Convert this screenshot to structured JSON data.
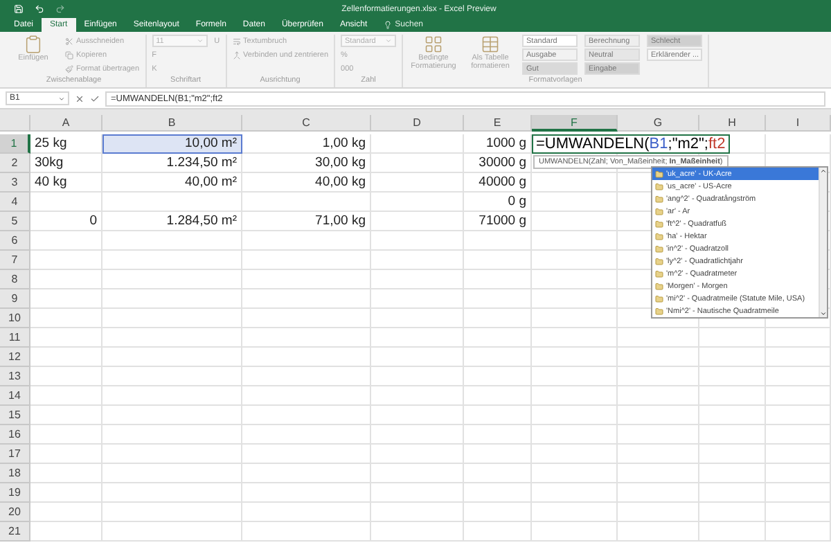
{
  "window": {
    "title": "Zellenformatierungen.xlsx  -  Excel Preview"
  },
  "tabs": [
    {
      "label": "Datei",
      "selected": false
    },
    {
      "label": "Start",
      "selected": true
    },
    {
      "label": "Einfügen",
      "selected": false
    },
    {
      "label": "Seitenlayout",
      "selected": false
    },
    {
      "label": "Formeln",
      "selected": false
    },
    {
      "label": "Daten",
      "selected": false
    },
    {
      "label": "Überprüfen",
      "selected": false
    },
    {
      "label": "Ansicht",
      "selected": false
    }
  ],
  "search": {
    "placeholder": "Suchen"
  },
  "ribbon": {
    "groups": [
      {
        "label": "Zwischenablage",
        "items": [
          {
            "kind": "paste",
            "label": "Einfügen"
          },
          {
            "kind": "cut",
            "label": "Ausschneiden"
          },
          {
            "kind": "copy",
            "label": "Kopieren"
          },
          {
            "kind": "brush",
            "label": "Format übertragen"
          }
        ]
      },
      {
        "label": "Schriftart",
        "items": [
          {
            "kind": "field",
            "value": "11"
          },
          {
            "kind": "glyph",
            "label": "F"
          },
          {
            "kind": "glyph",
            "label": "K"
          },
          {
            "kind": "glyph",
            "label": "U"
          }
        ]
      },
      {
        "label": "Ausrichtung",
        "items": [
          {
            "kind": "wrap",
            "label": "Textumbruch"
          },
          {
            "kind": "merge",
            "label": "Verbinden und zentrieren"
          }
        ]
      },
      {
        "label": "Zahl",
        "items": [
          {
            "kind": "field",
            "value": "Standard"
          },
          {
            "kind": "glyph",
            "label": "%"
          },
          {
            "kind": "glyph",
            "label": "000"
          }
        ]
      },
      {
        "label": "Formatvorlagen",
        "items": [
          {
            "kind": "conditional",
            "label": "Bedingte Formatierung"
          },
          {
            "kind": "table",
            "label": "Als Tabelle formatieren"
          },
          {
            "kind": "style",
            "label": "Standard",
            "color": "#ffffff"
          },
          {
            "kind": "style",
            "label": "Ausgabe",
            "color": "#f2f2f2"
          },
          {
            "kind": "style",
            "label": "Gut",
            "color": "#d9d9d9"
          },
          {
            "kind": "style",
            "label": "Berechnung",
            "color": "#eeeeee"
          },
          {
            "kind": "style",
            "label": "Neutral",
            "color": "#e6e6e6"
          },
          {
            "kind": "style",
            "label": "Eingabe",
            "color": "#d0d0d0"
          },
          {
            "kind": "style",
            "label": "Schlecht",
            "color": "#cfcfcf"
          },
          {
            "kind": "style",
            "label": "Erklärender ...",
            "color": "#f7f7f7"
          }
        ]
      }
    ]
  },
  "formula_bar": {
    "name_box": "B1",
    "formula": "=UMWANDELN(B1;\"m2\";ft2"
  },
  "sheet": {
    "columns": [
      {
        "label": "A",
        "selected": false
      },
      {
        "label": "B",
        "selected": false
      },
      {
        "label": "C",
        "selected": false
      },
      {
        "label": "D",
        "selected": false
      },
      {
        "label": "E",
        "selected": false
      },
      {
        "label": "F",
        "selected": true
      },
      {
        "label": "G",
        "selected": false
      },
      {
        "label": "H",
        "selected": false
      },
      {
        "label": "I",
        "selected": false
      }
    ],
    "rows": [
      {
        "number": "1",
        "selected": true,
        "a": {
          "text": "25 kg",
          "kind": "text"
        },
        "b": {
          "text": "10,00 m²",
          "kind": "number",
          "referenced": true
        },
        "c": {
          "text": "1,00 kg",
          "kind": "number"
        },
        "e": {
          "text": "1000  g",
          "kind": "number"
        },
        "f": {
          "kind": "formula",
          "parts": [
            {
              "text": "=UMWANDELN(",
              "color": "#000000"
            },
            {
              "text": "B1",
              "color": "#3c5fc8"
            },
            {
              "text": ";\"m2\";",
              "color": "#000000"
            },
            {
              "text": "ft2",
              "color": "#c0392b"
            }
          ]
        }
      },
      {
        "number": "2",
        "selected": false,
        "a": {
          "text": "30kg",
          "kind": "text"
        },
        "b": {
          "text": "1.234,50 m²",
          "kind": "number"
        },
        "c": {
          "text": "30,00 kg",
          "kind": "number"
        },
        "e": {
          "text": "30000  g",
          "kind": "number"
        }
      },
      {
        "number": "3",
        "selected": false,
        "a": {
          "text": "40 kg",
          "kind": "text"
        },
        "b": {
          "text": "40,00 m²",
          "kind": "number"
        },
        "c": {
          "text": "40,00 kg",
          "kind": "number"
        },
        "e": {
          "text": "40000  g",
          "kind": "number"
        }
      },
      {
        "number": "4",
        "selected": false,
        "e": {
          "text": "0  g",
          "kind": "number"
        }
      },
      {
        "number": "5",
        "selected": false,
        "a": {
          "text": "0",
          "kind": "number"
        },
        "b": {
          "text": "1.284,50 m²",
          "kind": "number"
        },
        "c": {
          "text": "71,00 kg",
          "kind": "number"
        },
        "e": {
          "text": "71000  g",
          "kind": "number"
        }
      },
      {
        "number": "6",
        "selected": false
      },
      {
        "number": "7",
        "selected": false
      },
      {
        "number": "8",
        "selected": false
      },
      {
        "number": "9",
        "selected": false
      },
      {
        "number": "10",
        "selected": false
      },
      {
        "number": "11",
        "selected": false
      },
      {
        "number": "12",
        "selected": false
      },
      {
        "number": "13",
        "selected": false
      },
      {
        "number": "14",
        "selected": false
      },
      {
        "number": "15",
        "selected": false
      },
      {
        "number": "16",
        "selected": false
      },
      {
        "number": "17",
        "selected": false
      },
      {
        "number": "18",
        "selected": false
      },
      {
        "number": "19",
        "selected": false
      },
      {
        "number": "20",
        "selected": false
      },
      {
        "number": "21",
        "selected": false
      }
    ]
  },
  "tooltip": "UMWANDELN(Zahl; Von_Maßeinheit; **In_Maßeinheit**)",
  "autocomplete": [
    {
      "label": "'uk_acre' - UK-Acre",
      "selected": true
    },
    {
      "label": "'us_acre' - US-Acre",
      "selected": false
    },
    {
      "label": "'ang^2' - Quadratångström",
      "selected": false
    },
    {
      "label": "'ar' - Ar",
      "selected": false
    },
    {
      "label": "'ft^2' - Quadratfuß",
      "selected": false
    },
    {
      "label": "'ha' - Hektar",
      "selected": false
    },
    {
      "label": "'in^2' - Quadratzoll",
      "selected": false
    },
    {
      "label": "'ly^2' - Quadratlichtjahr",
      "selected": false
    },
    {
      "label": "'m^2' - Quadratmeter",
      "selected": false
    },
    {
      "label": "'Morgen' - Morgen",
      "selected": false
    },
    {
      "label": "'mi^2' - Quadratmeile (Statute Mile, USA)",
      "selected": false
    },
    {
      "label": "'Nmi^2' - Nautische Quadratmeile",
      "selected": false
    }
  ]
}
